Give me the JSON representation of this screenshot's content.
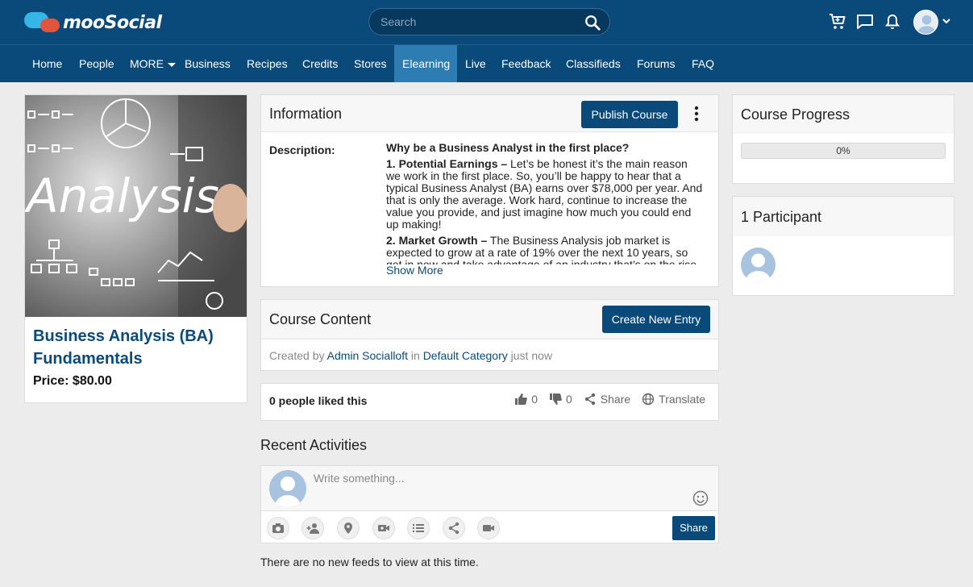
{
  "brand": {
    "name": "mooSocial"
  },
  "search": {
    "placeholder": "Search"
  },
  "nav": {
    "items": [
      {
        "label": "Home"
      },
      {
        "label": "People"
      },
      {
        "label": "MORE"
      },
      {
        "label": "Business"
      },
      {
        "label": "Recipes"
      },
      {
        "label": "Credits"
      },
      {
        "label": "Stores"
      },
      {
        "label": "Elearning",
        "active": true
      },
      {
        "label": "Live"
      },
      {
        "label": "Feedback"
      },
      {
        "label": "Classifieds"
      },
      {
        "label": "Forums"
      },
      {
        "label": "FAQ"
      }
    ]
  },
  "course": {
    "image_text": "Analysis",
    "title": "Business Analysis (BA) Fundamentals",
    "price": "Price: $80.00"
  },
  "information": {
    "title": "Information",
    "publish_label": "Publish Course",
    "description_label": "Description:",
    "heading": "Why be a Business Analyst in the first place?",
    "p1_bold": "1. Potential Earnings –",
    "p1_text": " Let’s be honest it’s the main reason we work in the first place. So, you’ll be happy to hear that a typical Business Analyst (BA) earns over $78,000 per year. And that is only the average. Work hard, continue to increase the value you provide, and just imagine how much you could end up making!",
    "p2_bold": "2. Market Growth –",
    "p2_text": " The Business Analysis job market is expected to grow at a rate of 19% over the next 10 years, so get in now and take advantage of an industry that’s on the rise. In fact, per the US Bureau of Labor Statistics, American employers",
    "show_more": "Show More"
  },
  "content": {
    "title": "Course Content",
    "create_label": "Create New Entry",
    "created_by": "Created by",
    "author": "Admin Socialloft",
    "in": "in",
    "category": "Default Category",
    "time": "just now"
  },
  "likes": {
    "summary": "0 people liked this",
    "like_count": "0",
    "dislike_count": "0",
    "share": "Share",
    "translate": "Translate"
  },
  "activities": {
    "title": "Recent Activities",
    "placeholder": "Write something...",
    "share_label": "Share",
    "empty": "There are no new feeds to view at this time."
  },
  "progress": {
    "title": "Course Progress",
    "value_text": "0%",
    "value": 0
  },
  "participants": {
    "title": "1 Participant"
  },
  "colors": {
    "primary": "#0a4a7a",
    "nav_active": "#2d7db3",
    "background": "#ececec"
  }
}
